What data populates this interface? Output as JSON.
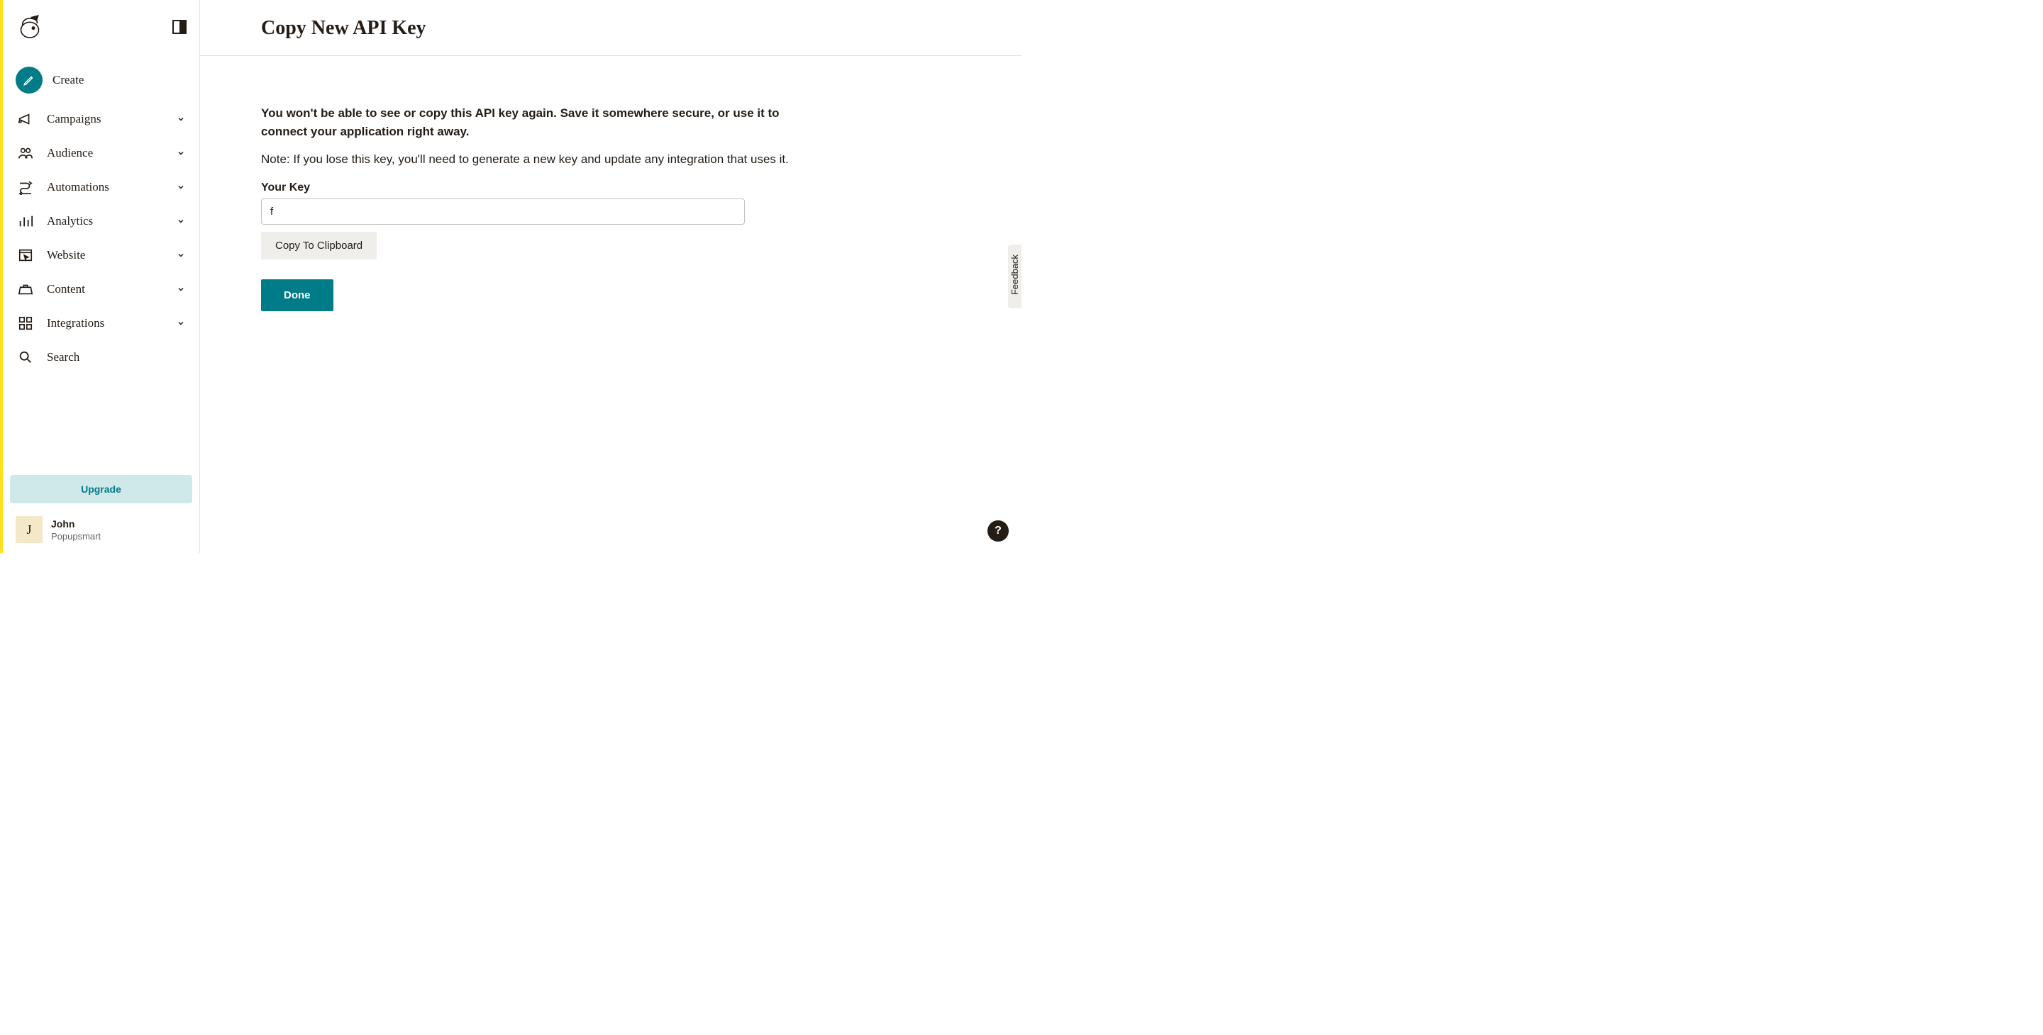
{
  "sidebar": {
    "create": "Create",
    "items": [
      {
        "label": "Campaigns",
        "hasChildren": true
      },
      {
        "label": "Audience",
        "hasChildren": true
      },
      {
        "label": "Automations",
        "hasChildren": true
      },
      {
        "label": "Analytics",
        "hasChildren": true
      },
      {
        "label": "Website",
        "hasChildren": true
      },
      {
        "label": "Content",
        "hasChildren": true
      },
      {
        "label": "Integrations",
        "hasChildren": true
      },
      {
        "label": "Search",
        "hasChildren": false
      }
    ],
    "upgrade": "Upgrade",
    "account": {
      "avatarLetter": "J",
      "name": "John",
      "org": "Popupsmart"
    }
  },
  "page": {
    "title": "Copy New API Key",
    "warning": "You won't be able to see or copy this API key again. Save it somewhere secure, or use it to connect your application right away.",
    "note": "Note: If you lose this key, you'll need to generate a new key and update any integration that uses it.",
    "fieldLabel": "Your Key",
    "keyValue": "f",
    "copyBtn": "Copy To Clipboard",
    "doneBtn": "Done"
  },
  "feedback": "Feedback",
  "help": "?"
}
